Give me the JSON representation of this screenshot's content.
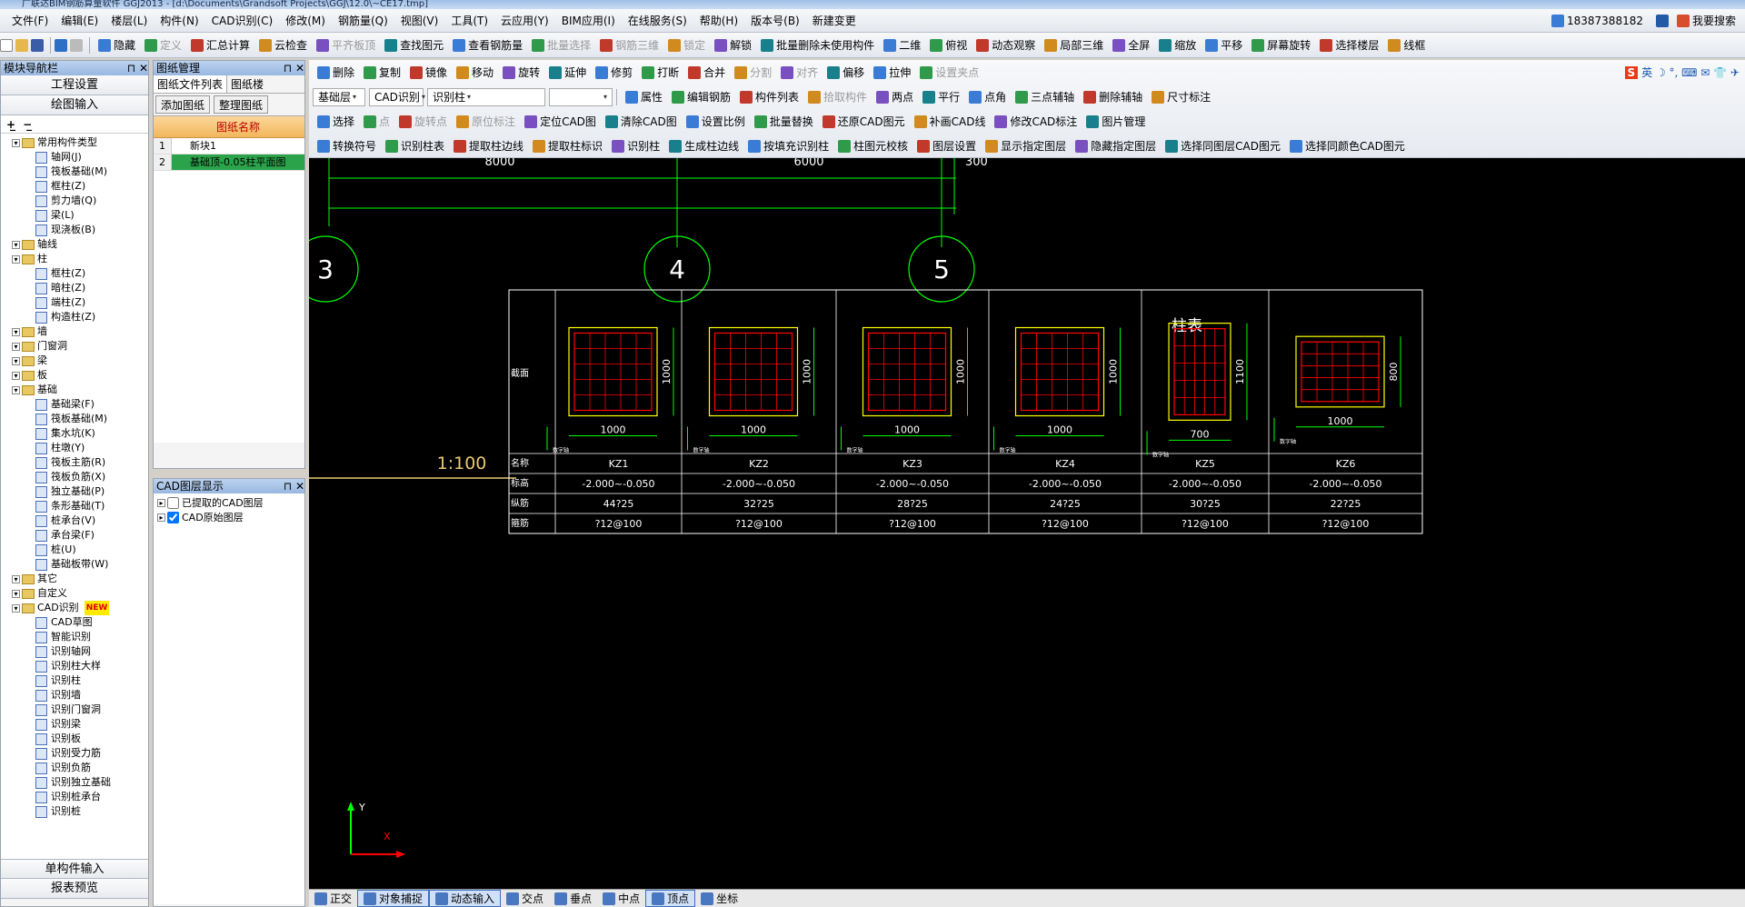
{
  "title": "广联达BIM钢筋算量软件 GGJ2013 - [d:\\Documents\\Grandsoft Projects\\GGJ\\12.0\\~CE17.tmp]",
  "menu": [
    "文件(F)",
    "编辑(E)",
    "楼层(L)",
    "构件(N)",
    "CAD识别(C)",
    "修改(M)",
    "钢筋量(Q)",
    "视图(V)",
    "工具(T)",
    "云应用(Y)",
    "BIM应用(I)",
    "在线服务(S)",
    "帮助(H)",
    "版本号(B)",
    "新建变更"
  ],
  "user": {
    "phone": "18387388182",
    "search": "我要搜索"
  },
  "toolbar1": [
    "隐藏",
    "定义",
    "汇总计算",
    "云检查",
    "平齐板顶",
    "查找图元",
    "查看钢筋量",
    "批量选择",
    "钢筋三维",
    "锁定",
    "解锁",
    "批量删除未使用构件",
    "二维",
    "俯视",
    "动态观察",
    "局部三维",
    "全屏",
    "缩放",
    "平移",
    "屏幕旋转",
    "选择楼层",
    "线框"
  ],
  "toolbar2": [
    "删除",
    "复制",
    "镜像",
    "移动",
    "旋转",
    "延伸",
    "修剪",
    "打断",
    "合并",
    "分割",
    "对齐",
    "偏移",
    "拉伸",
    "设置夹点"
  ],
  "toolbar3": {
    "floor": "基础层",
    "cad": "CAD识别",
    "recog": "识别柱",
    "items": [
      "属性",
      "编辑钢筋",
      "构件列表",
      "拾取构件",
      "两点",
      "平行",
      "点角",
      "三点辅轴",
      "删除辅轴",
      "尺寸标注"
    ]
  },
  "toolbar4": [
    "选择",
    "点",
    "旋转点",
    "原位标注",
    "定位CAD图",
    "清除CAD图",
    "设置比例",
    "批量替换",
    "还原CAD图元",
    "补画CAD线",
    "修改CAD标注",
    "图片管理"
  ],
  "toolbar5": [
    "转换符号",
    "识别柱表",
    "提取柱边线",
    "提取柱标识",
    "识别柱",
    "生成柱边线",
    "按填充识别柱",
    "柱图元校核",
    "图层设置",
    "显示指定图层",
    "隐藏指定图层",
    "选择同图层CAD图元",
    "选择同颜色CAD图元"
  ],
  "nav": {
    "title": "模块导航栏",
    "btn1": "工程设置",
    "btn2": "绘图输入",
    "bottom1": "单构件输入",
    "bottom2": "报表预览",
    "tree": [
      {
        "lvl": 0,
        "t": "常用构件类型",
        "f": 1
      },
      {
        "lvl": 1,
        "t": "轴网(J)"
      },
      {
        "lvl": 1,
        "t": "筏板基础(M)"
      },
      {
        "lvl": 1,
        "t": "框柱(Z)"
      },
      {
        "lvl": 1,
        "t": "剪力墙(Q)"
      },
      {
        "lvl": 1,
        "t": "梁(L)"
      },
      {
        "lvl": 1,
        "t": "现浇板(B)"
      },
      {
        "lvl": 0,
        "t": "轴线",
        "f": 1
      },
      {
        "lvl": 0,
        "t": "柱",
        "f": 1
      },
      {
        "lvl": 1,
        "t": "框柱(Z)"
      },
      {
        "lvl": 1,
        "t": "暗柱(Z)"
      },
      {
        "lvl": 1,
        "t": "端柱(Z)"
      },
      {
        "lvl": 1,
        "t": "构造柱(Z)"
      },
      {
        "lvl": 0,
        "t": "墙",
        "f": 1
      },
      {
        "lvl": 0,
        "t": "门窗洞",
        "f": 1
      },
      {
        "lvl": 0,
        "t": "梁",
        "f": 1
      },
      {
        "lvl": 0,
        "t": "板",
        "f": 1
      },
      {
        "lvl": 0,
        "t": "基础",
        "f": 1
      },
      {
        "lvl": 1,
        "t": "基础梁(F)"
      },
      {
        "lvl": 1,
        "t": "筏板基础(M)"
      },
      {
        "lvl": 1,
        "t": "集水坑(K)"
      },
      {
        "lvl": 1,
        "t": "柱墩(Y)"
      },
      {
        "lvl": 1,
        "t": "筏板主筋(R)"
      },
      {
        "lvl": 1,
        "t": "筏板负筋(X)"
      },
      {
        "lvl": 1,
        "t": "独立基础(P)"
      },
      {
        "lvl": 1,
        "t": "条形基础(T)"
      },
      {
        "lvl": 1,
        "t": "桩承台(V)"
      },
      {
        "lvl": 1,
        "t": "承台梁(F)"
      },
      {
        "lvl": 1,
        "t": "桩(U)"
      },
      {
        "lvl": 1,
        "t": "基础板带(W)"
      },
      {
        "lvl": 0,
        "t": "其它",
        "f": 1
      },
      {
        "lvl": 0,
        "t": "自定义",
        "f": 1
      },
      {
        "lvl": 0,
        "t": "CAD识别",
        "f": 1,
        "badge": "NEW"
      },
      {
        "lvl": 1,
        "t": "CAD草图"
      },
      {
        "lvl": 1,
        "t": "智能识别"
      },
      {
        "lvl": 1,
        "t": "识别轴网"
      },
      {
        "lvl": 1,
        "t": "识别柱大样"
      },
      {
        "lvl": 1,
        "t": "识别柱"
      },
      {
        "lvl": 1,
        "t": "识别墙"
      },
      {
        "lvl": 1,
        "t": "识别门窗洞"
      },
      {
        "lvl": 1,
        "t": "识别梁"
      },
      {
        "lvl": 1,
        "t": "识别板"
      },
      {
        "lvl": 1,
        "t": "识别受力筋"
      },
      {
        "lvl": 1,
        "t": "识别负筋"
      },
      {
        "lvl": 1,
        "t": "识别独立基础"
      },
      {
        "lvl": 1,
        "t": "识别桩承台"
      },
      {
        "lvl": 1,
        "t": "识别桩"
      }
    ]
  },
  "drawings": {
    "title": "图纸管理",
    "tab1": "图纸文件列表",
    "tab2": "图纸楼",
    "add": "添加图纸",
    "arrange": "整理图纸",
    "col": "图纸名称",
    "rows": [
      {
        "no": "1",
        "name": "新块1"
      },
      {
        "no": "2",
        "name": "基础顶-0.05柱平面图"
      }
    ]
  },
  "layers": {
    "title": "CAD图层显示",
    "items": [
      "已提取的CAD图层",
      "CAD原始图层"
    ]
  },
  "cad": {
    "dims": [
      "8000",
      "6000",
      "300"
    ],
    "axes": [
      "3",
      "4",
      "5"
    ],
    "scale": "1:100",
    "table_title": "柱表",
    "row_labels": [
      "截面",
      "名称",
      "标高",
      "纵筋",
      "箍筋"
    ],
    "cols": [
      {
        "name": "KZ1",
        "h": "1000",
        "w": "1000",
        "elev": "-2.000~-0.050",
        "main": "44?25",
        "stir": "?12@100"
      },
      {
        "name": "KZ2",
        "h": "1000",
        "w": "1000",
        "elev": "-2.000~-0.050",
        "main": "32?25",
        "stir": "?12@100"
      },
      {
        "name": "KZ3",
        "h": "1000",
        "w": "1000",
        "elev": "-2.000~-0.050",
        "main": "28?25",
        "stir": "?12@100"
      },
      {
        "name": "KZ4",
        "h": "1000",
        "w": "1000",
        "elev": "-2.000~-0.050",
        "main": "24?25",
        "stir": "?12@100"
      },
      {
        "name": "KZ5",
        "h": "1100",
        "w": "700",
        "elev": "-2.000~-0.050",
        "main": "30?25",
        "stir": "?12@100"
      },
      {
        "name": "KZ6",
        "h": "800",
        "w": "1000",
        "elev": "-2.000~-0.050",
        "main": "22?25",
        "stir": "?12@100"
      }
    ],
    "small_label": "数字轴",
    "ucs_y": "Y",
    "ucs_x": "X"
  },
  "status": [
    "正交",
    "对象捕捉",
    "动态输入",
    "交点",
    "垂点",
    "中点",
    "顶点",
    "坐标"
  ]
}
